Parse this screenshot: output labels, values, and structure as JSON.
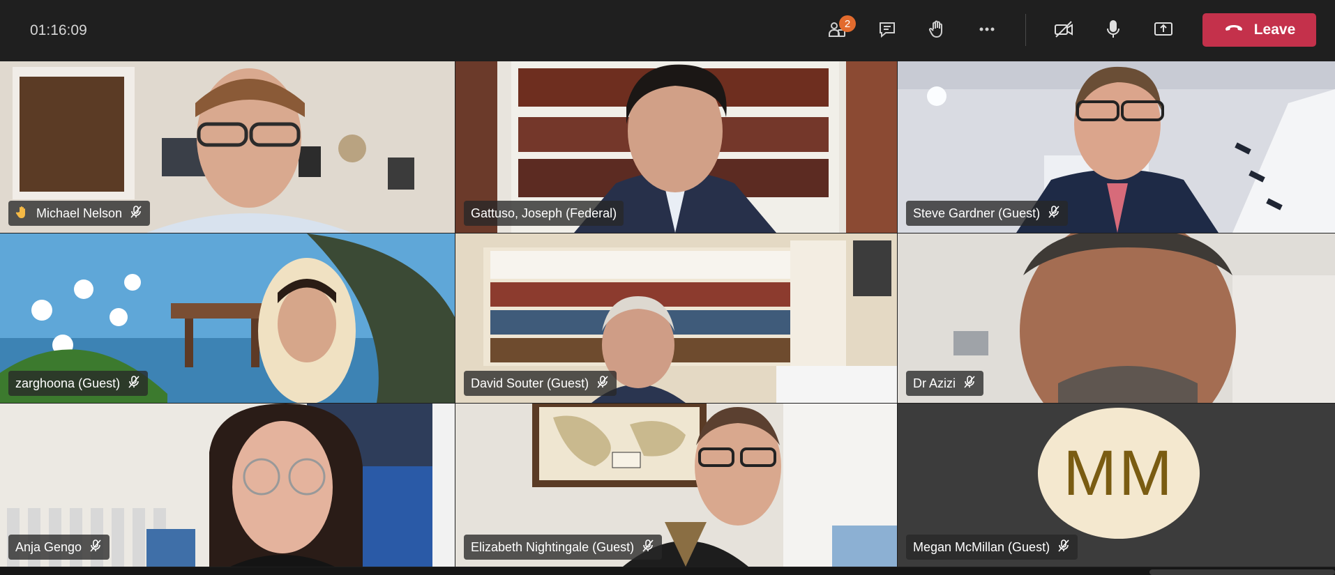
{
  "call": {
    "duration": "01:16:09",
    "participants_badge": "2",
    "leave_label": "Leave"
  },
  "colors": {
    "topbar": "#1f1f1f",
    "leave_button": "#c4314b",
    "badge": "#e26b2e",
    "avatar_bg": "#f4e8cf",
    "avatar_text": "#7a5c12"
  },
  "toolbar": {
    "icons": [
      "people-icon",
      "chat-icon",
      "raise-hand-icon",
      "more-icon",
      "camera-off-icon",
      "microphone-icon",
      "share-screen-icon",
      "phone-hangup-icon"
    ]
  },
  "participants": [
    {
      "name": "Michael Nelson",
      "hand_raised": true,
      "muted": true
    },
    {
      "name": "Gattuso, Joseph (Federal)",
      "hand_raised": false,
      "muted": false
    },
    {
      "name": "Steve Gardner (Guest)",
      "hand_raised": false,
      "muted": true
    },
    {
      "name": "zarghoona (Guest)",
      "hand_raised": false,
      "muted": true
    },
    {
      "name": "David Souter (Guest)",
      "hand_raised": false,
      "muted": true
    },
    {
      "name": "Dr Azizi",
      "hand_raised": false,
      "muted": true
    },
    {
      "name": "Anja Gengo",
      "hand_raised": false,
      "muted": true
    },
    {
      "name": "Elizabeth Nightingale (Guest)",
      "hand_raised": false,
      "muted": true
    },
    {
      "name": "Megan McMillan (Guest)",
      "hand_raised": false,
      "muted": true,
      "initials": "MM"
    }
  ]
}
